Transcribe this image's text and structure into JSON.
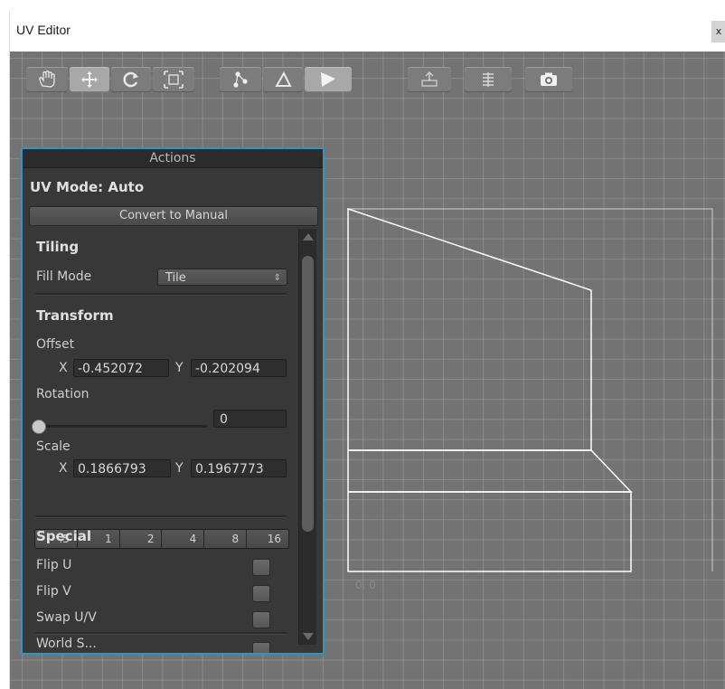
{
  "window": {
    "title": "UV Editor",
    "close_glyph": "x"
  },
  "toolbar": {
    "groups": [
      {
        "name": "transform-tools",
        "items": [
          "hand-icon",
          "move-icon",
          "rotate-icon",
          "scale-icon"
        ],
        "selected": "move-icon"
      },
      {
        "name": "selection-mode",
        "items": [
          "vertex-icon",
          "edge-icon",
          "face-icon"
        ],
        "selected": "face-icon"
      },
      {
        "name": "actions",
        "items": [
          "export-icon",
          "render-icon",
          "screenshot-icon"
        ]
      }
    ]
  },
  "panel": {
    "header": "Actions",
    "uv_mode": "UV Mode: Auto",
    "convert_button": "Convert to Manual",
    "tiling": {
      "heading": "Tiling",
      "fill_mode_label": "Fill Mode",
      "fill_mode_value": "Tile",
      "dropdown_arrow": "⇕"
    },
    "transform": {
      "heading": "Transform",
      "offset_label": "Offset",
      "x_label": "X",
      "y_label": "Y",
      "offset_x": "-0.452072",
      "offset_y": "-0.202094",
      "rotation_label": "Rotation",
      "rotation_value": "0",
      "rotation_slider": 0,
      "scale_label": "Scale",
      "scale_x": "0.1866793",
      "scale_y": "0.1967773",
      "presets": [
        ".5",
        "1",
        "2",
        "4",
        "8",
        "16"
      ]
    },
    "special": {
      "heading": "Special",
      "flip_u": "Flip U",
      "flip_v": "Flip V",
      "swap_uv": "Swap U/V",
      "truncated": "World S...",
      "flip_u_checked": false,
      "flip_v_checked": false,
      "swap_uv_checked": false
    }
  },
  "canvas": {
    "origin_label": "0, 0"
  },
  "colors": {
    "grid_bg": "#737373",
    "panel_bg": "#383838",
    "panel_border": "#3a8fbd",
    "uv_lines": "#ffffff"
  }
}
